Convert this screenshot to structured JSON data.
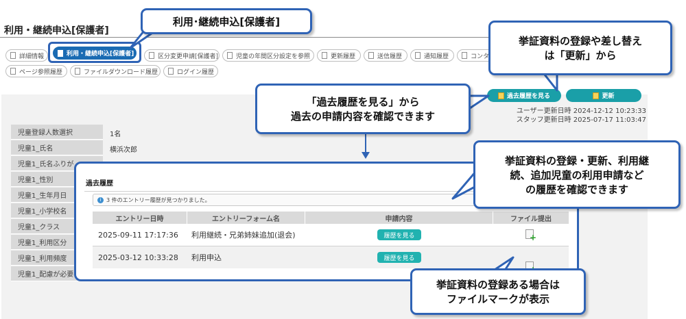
{
  "page": {
    "title": "利用・継続申込[保護者]"
  },
  "tabs": [
    {
      "label": "詳細情報",
      "active": false
    },
    {
      "label": "利用・継続申込[保護者]",
      "active": true
    },
    {
      "label": "区分変更申請[保護者]",
      "active": false
    },
    {
      "label": "児童の年間区分設定を参照",
      "active": false
    },
    {
      "label": "更新履歴",
      "active": false
    },
    {
      "label": "送信履歴",
      "active": false
    },
    {
      "label": "通知履歴",
      "active": false
    },
    {
      "label": "コンタ",
      "active": false
    },
    {
      "label": "ページ参照履歴",
      "active": false
    },
    {
      "label": "ファイルダウンロード履歴",
      "active": false
    },
    {
      "label": "ログイン履歴",
      "active": false
    }
  ],
  "actions": {
    "history_label": "過去履歴を見る",
    "update_label": "更新"
  },
  "meta": {
    "user_updated": "ユーザー更新日時 2024-12-12 10:23:33",
    "staff_updated": "スタッフ更新日時 2025-07-17 11:03:47"
  },
  "fields": [
    {
      "label": "児童登録人数選択",
      "value": "1名"
    },
    {
      "label": "児童1_氏名",
      "value": "横浜次郎"
    },
    {
      "label": "児童1_氏名ふりが",
      "value": ""
    },
    {
      "label": "児童1_性別",
      "value": ""
    },
    {
      "label": "児童1_生年月日",
      "value": ""
    },
    {
      "label": "児童1_小学校名",
      "value": ""
    },
    {
      "label": "児童1_クラス",
      "value": ""
    },
    {
      "label": "児童1_利用区分",
      "value": ""
    },
    {
      "label": "児童1_利用頻度",
      "value": ""
    },
    {
      "label": "児童1_配慮が必要",
      "value": ""
    }
  ],
  "history": {
    "title": "過去履歴",
    "notice": "3 件のエントリー履歴が見つかりました。",
    "columns": [
      "エントリー日時",
      "エントリーフォーム名",
      "申請内容",
      "ファイル提出"
    ],
    "rows": [
      {
        "datetime": "2025-09-11 17:17:36",
        "form": "利用継続・兄弟姉妹追加(退会)",
        "action": "履歴を見る",
        "file": "file-add-icon"
      },
      {
        "datetime": "2025-03-12 10:33:28",
        "form": "利用申込",
        "action": "履歴を見る",
        "file": "file-add-icon"
      }
    ]
  },
  "callouts": {
    "tab": "利用･継続申込[保護者]",
    "update": [
      "挙証資料の登録や差し替え",
      "は「更新」から"
    ],
    "history_btn": [
      "「過去履歴を見る」から",
      "過去の申請内容を確認できます"
    ],
    "records": [
      "挙証資料の登録・更新、利用継",
      "続、追加児童の利用申請など",
      "の履歴を確認できます"
    ],
    "file": [
      "挙証資料の登録ある場合は",
      "ファイルマークが表示"
    ]
  },
  "colors": {
    "accent_blue": "#2f63b5",
    "tab_active": "#1a6bb3",
    "teal_button": "#1a9fa8"
  }
}
